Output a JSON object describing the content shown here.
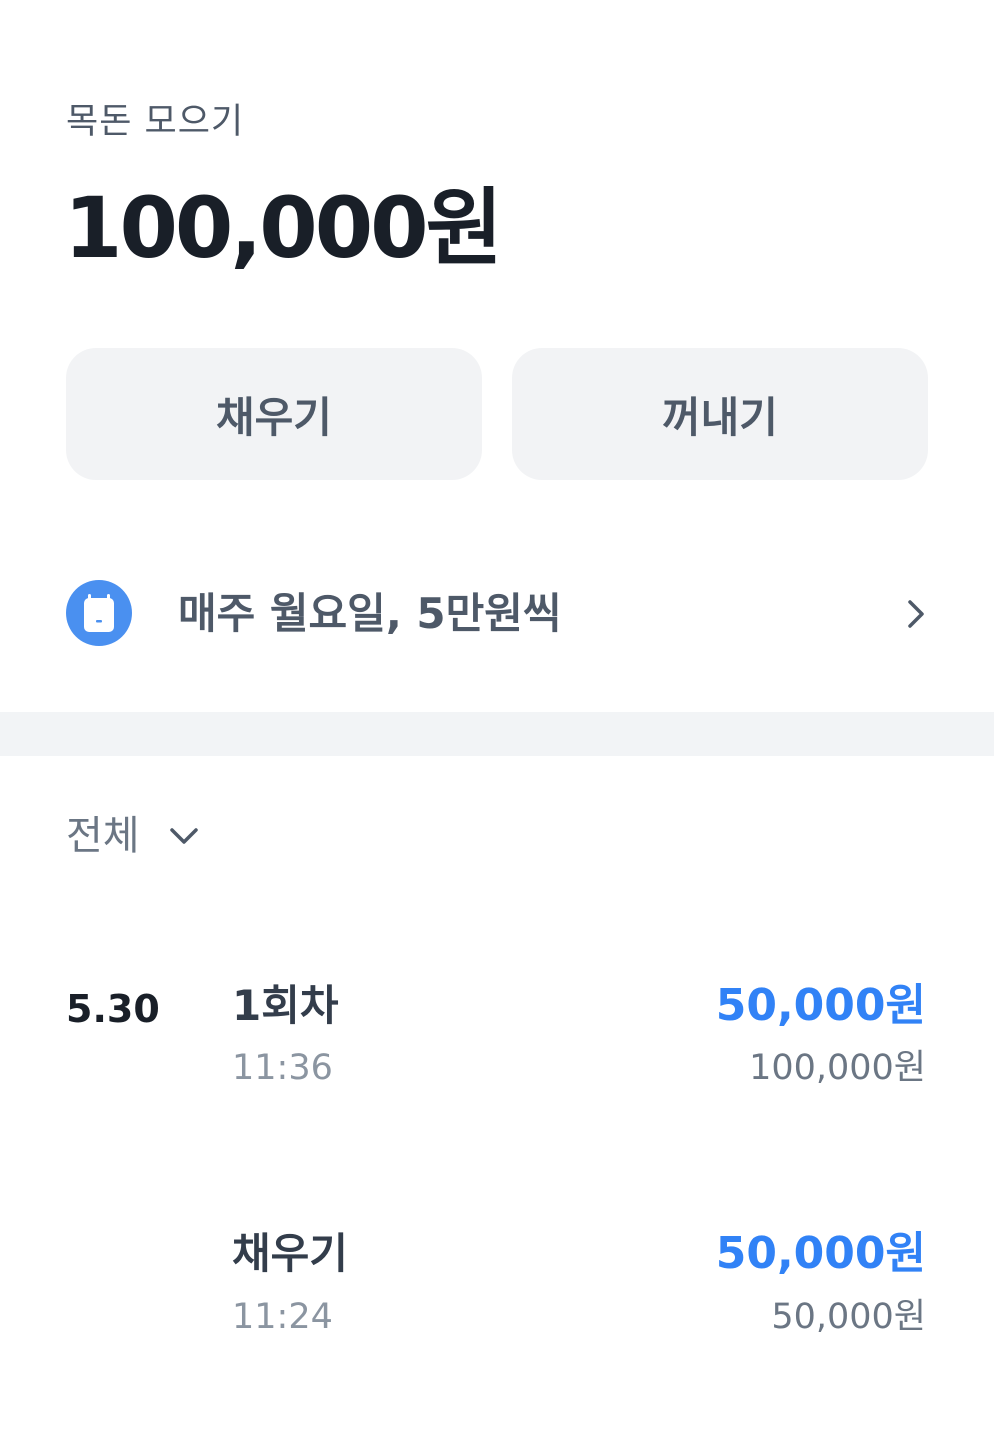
{
  "account": {
    "name": "목돈 모으기",
    "balance": "100,000원"
  },
  "actions": {
    "fill_label": "채우기",
    "withdraw_label": "꺼내기"
  },
  "schedule": {
    "text": "매주 월요일, 5만원씩",
    "icon": "calendar-icon",
    "accent": "#4a90f0"
  },
  "filter": {
    "label": "전체"
  },
  "transactions": [
    {
      "date": "5.30",
      "title": "1회차",
      "time": "11:36",
      "amount": "50,000원",
      "balance_after": "100,000원"
    },
    {
      "date": "",
      "title": "채우기",
      "time": "11:24",
      "amount": "50,000원",
      "balance_after": "50,000원"
    }
  ],
  "colors": {
    "amount": "#3182f6",
    "button_bg": "#f2f3f5",
    "divider": "#f2f4f6"
  }
}
